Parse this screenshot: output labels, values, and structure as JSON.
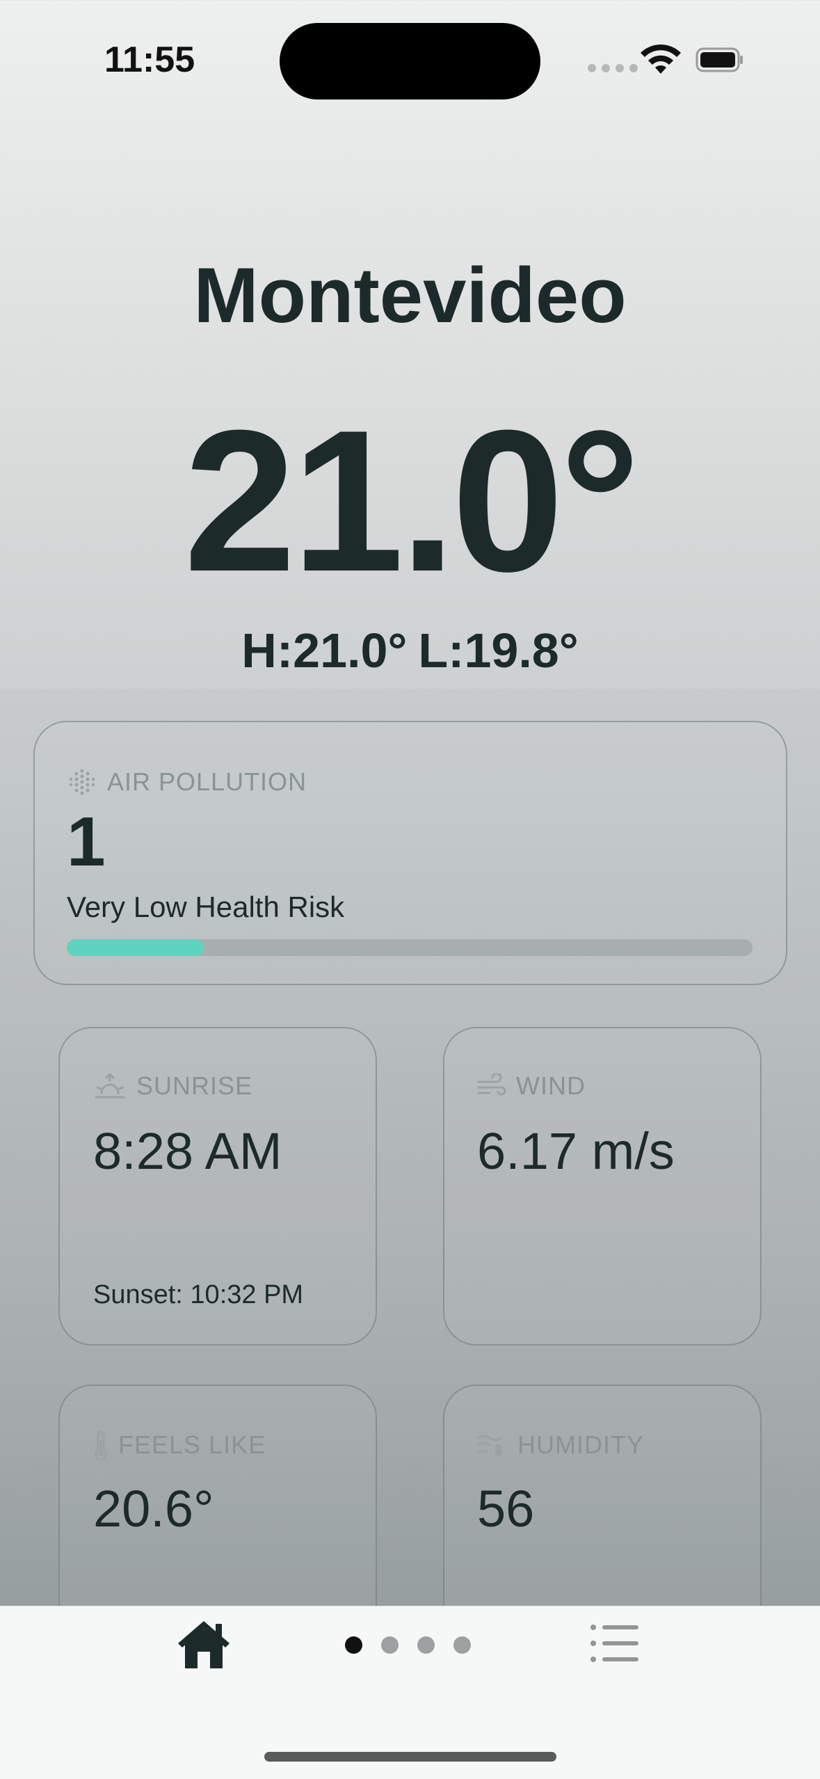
{
  "status_bar": {
    "time": "11:55"
  },
  "weather": {
    "city": "Montevideo",
    "temperature": "21.0°",
    "high": "H:21.0°",
    "low": "L:19.8°"
  },
  "air_pollution": {
    "label": "AIR POLLUTION",
    "value": "1",
    "description": "Very Low Health Risk",
    "level_fraction": 0.2,
    "bar_color": "#5ed3bf"
  },
  "tiles": {
    "sunrise": {
      "label": "SUNRISE",
      "value": "8:28 AM",
      "sub": "Sunset: 10:32 PM",
      "icon": "sunrise-icon"
    },
    "wind": {
      "label": "WIND",
      "value": "6.17 m/s",
      "icon": "wind-icon"
    },
    "feels_like": {
      "label": "FEELS LIKE",
      "value": "20.6°",
      "icon": "thermometer-icon"
    },
    "humidity": {
      "label": "HUMIDITY",
      "value": "56",
      "icon": "humidity-icon"
    }
  },
  "tab_bar": {
    "pages": 4,
    "active_page": 1,
    "left_icon": "home-icon",
    "right_icon": "list-icon"
  }
}
